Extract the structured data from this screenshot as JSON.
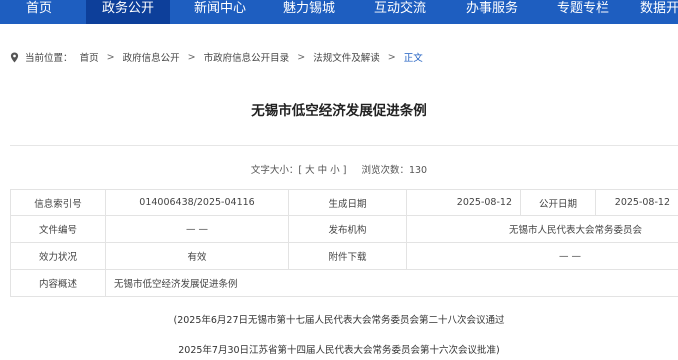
{
  "nav": {
    "items": [
      {
        "label": "首页"
      },
      {
        "label": "政务公开"
      },
      {
        "label": "新闻中心"
      },
      {
        "label": "魅力锡城"
      },
      {
        "label": "互动交流"
      },
      {
        "label": "办事服务"
      },
      {
        "label": "专题专栏"
      },
      {
        "label": "数据开"
      }
    ],
    "active_color": "#0d3f9a",
    "bar_color": "#1e5ec0"
  },
  "breadcrumb": {
    "icon": "location-pin-icon",
    "prefix": "当前位置：",
    "items": [
      "首页",
      "政府信息公开",
      "市政府信息公开目录",
      "法规文件及解读",
      "正文"
    ],
    "separator": ">"
  },
  "article": {
    "title": "无锡市低空经济发展促进条例",
    "font_size_label": "文字大小：",
    "font_size_options": "[ 大 中 小 ]",
    "views_label": "浏览次数：",
    "views": "130",
    "body": [
      "(2025年6月27日无锡市第十七届人民代表大会常务委员会第二十八次会议通过",
      "2025年7月30日江苏省第十四届人民代表大会常务委员会第十六次会议批准)"
    ]
  },
  "info_table": {
    "index_label": "信息索引号",
    "index_value": "014006438/2025-04116",
    "created_label": "生成日期",
    "created_value": "2025-08-12",
    "published_label": "公开日期",
    "published_value": "2025-08-12",
    "docno_label": "文件编号",
    "docno_value": "— —",
    "issuer_label": "发布机构",
    "issuer_value": "无锡市人民代表大会常务委员会",
    "validity_label": "效力状况",
    "validity_value": "有效",
    "attachment_label": "附件下载",
    "attachment_value": "— —",
    "summary_label": "内容概述",
    "summary_value": "无锡市低空经济发展促进条例"
  }
}
